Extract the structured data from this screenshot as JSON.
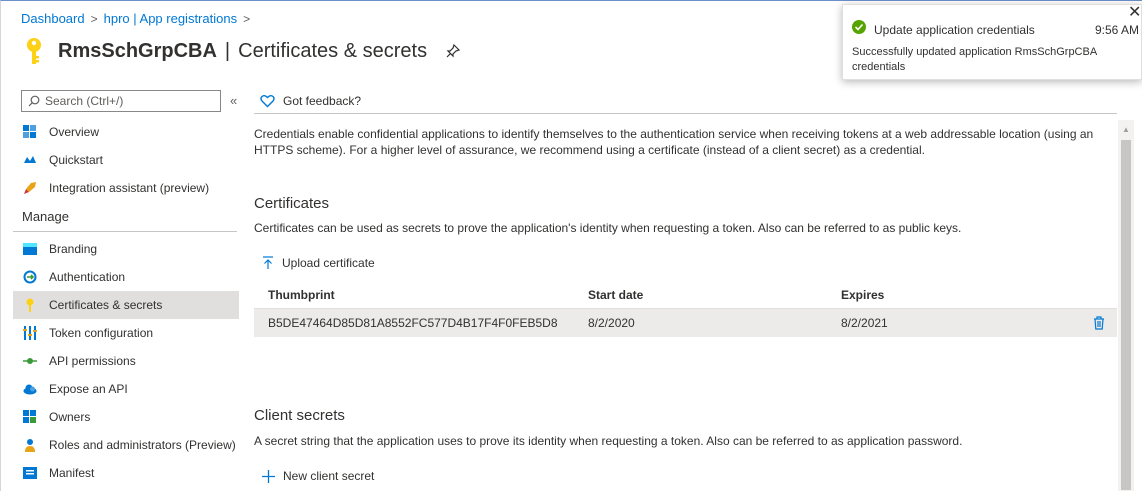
{
  "breadcrumb": {
    "items": [
      "Dashboard",
      "hpro | App registrations"
    ],
    "separator": ">"
  },
  "header": {
    "app_name": "RmsSchGrpCBA",
    "divider": "|",
    "page_title": "Certificates & secrets"
  },
  "sidebar": {
    "search_placeholder": "Search (Ctrl+/)",
    "collapse_glyph": "«",
    "items": [
      {
        "label": "Overview",
        "icon": "overview-icon"
      },
      {
        "label": "Quickstart",
        "icon": "quickstart-icon"
      },
      {
        "label": "Integration assistant (preview)",
        "icon": "rocket-icon"
      }
    ],
    "section_label": "Manage",
    "manage_items": [
      {
        "label": "Branding",
        "icon": "branding-icon"
      },
      {
        "label": "Authentication",
        "icon": "authentication-icon"
      },
      {
        "label": "Certificates & secrets",
        "icon": "key-icon",
        "active": true
      },
      {
        "label": "Token configuration",
        "icon": "token-config-icon"
      },
      {
        "label": "API permissions",
        "icon": "api-permissions-icon"
      },
      {
        "label": "Expose an API",
        "icon": "cloud-icon"
      },
      {
        "label": "Owners",
        "icon": "owners-icon"
      },
      {
        "label": "Roles and administrators (Preview)",
        "icon": "roles-icon"
      },
      {
        "label": "Manifest",
        "icon": "manifest-icon"
      }
    ]
  },
  "toolbar": {
    "feedback_label": "Got feedback?"
  },
  "main": {
    "description": "Credentials enable confidential applications to identify themselves to the authentication service when receiving tokens at a web addressable location (using an HTTPS scheme). For a higher level of assurance, we recommend using a certificate (instead of a client secret) as a credential.",
    "certificates": {
      "title": "Certificates",
      "description": "Certificates can be used as secrets to prove the application's identity when requesting a token. Also can be referred to as public keys.",
      "upload_label": "Upload certificate",
      "columns": [
        "Thumbprint",
        "Start date",
        "Expires"
      ],
      "rows": [
        {
          "thumbprint": "B5DE47464D85D81A8552FC577D4B17F4F0FEB5D8",
          "start_date": "8/2/2020",
          "expires": "8/2/2021"
        }
      ]
    },
    "client_secrets": {
      "title": "Client secrets",
      "description": "A secret string that the application uses to prove its identity when requesting a token. Also can be referred to as application password.",
      "new_label": "New client secret"
    }
  },
  "notification": {
    "title": "Update application credentials",
    "time": "9:56 AM",
    "message": "Successfully updated application RmsSchGrpCBA credentials",
    "status_color": "#57a300"
  },
  "colors": {
    "accent": "#0078d4",
    "key_yellow": "#fcd116",
    "active_bg": "#e1dfdd"
  }
}
